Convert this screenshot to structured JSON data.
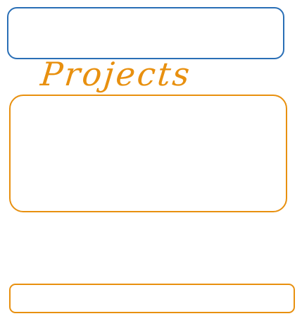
{
  "header": {
    "box_color": "#2a6fb6"
  },
  "projects": {
    "title": "Projects",
    "title_color": "#e8900f",
    "panel_color": "#e8900f"
  },
  "footer": {
    "box_color": "#e8900f"
  }
}
